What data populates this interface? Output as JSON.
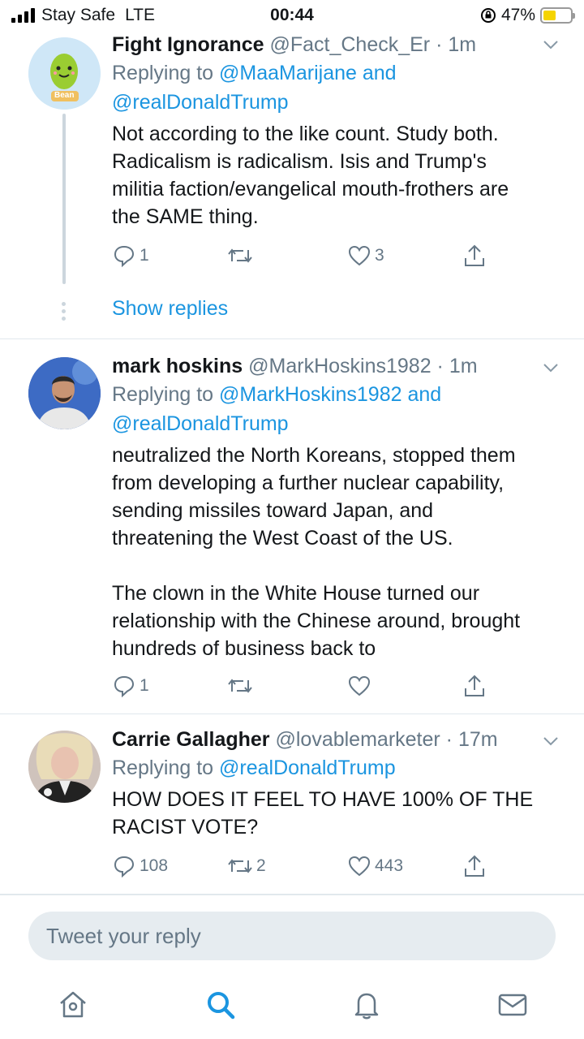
{
  "status_bar": {
    "carrier": "Stay Safe",
    "network": "LTE",
    "time": "00:44",
    "battery_percent": "47%",
    "battery_level": 0.47
  },
  "tweets": [
    {
      "name": "Fight Ignorance",
      "handle": "@Fact_Check_Er",
      "time": "1m",
      "reply_prefix": "Replying to ",
      "reply_mention_1": "@MaaMarijane and",
      "reply_mention_2": "@realDonaldTrump",
      "text": "Not according to the like count. Study both.\nRadicalism is radicalism. Isis and Trump's\nmilitia faction/evangelical mouth-frothers are\nthe SAME thing.",
      "reply_count": "1",
      "retweet_count": "",
      "like_count": "3",
      "avatar_label": "Bean",
      "show_replies": "Show replies"
    },
    {
      "name": "mark hoskins",
      "handle": "@MarkHoskins1982",
      "time": "1m",
      "reply_prefix": "Replying to ",
      "reply_mention_1": "@MarkHoskins1982 and",
      "reply_mention_2": "@realDonaldTrump",
      "text": "neutralized the North Koreans, stopped them\nfrom developing a further nuclear capability,\nsending missiles toward Japan, and\nthreatening the West Coast of the US.\n\nThe clown in the White House turned our\nrelationship with the Chinese around, brought\nhundreds of business back to",
      "reply_count": "1",
      "retweet_count": "",
      "like_count": ""
    },
    {
      "name": "Carrie Gallagher",
      "handle": "@lovablemarketer",
      "time": "17m",
      "reply_prefix": "Replying to ",
      "reply_mention_1": "@realDonaldTrump",
      "text": "HOW DOES IT FEEL TO HAVE 100% OF THE\nRACIST VOTE?",
      "reply_count": "108",
      "retweet_count": "2",
      "like_count": "443"
    }
  ],
  "reply_bar": {
    "placeholder": "Tweet your reply"
  },
  "tab_bar": {
    "icons": [
      "home-icon",
      "search-icon",
      "notifications-icon",
      "messages-icon"
    ],
    "active": "search-icon"
  },
  "colors": {
    "link": "#1b95e0",
    "secondary": "#657786",
    "divider": "#e1e8ed",
    "battery": "#f5d400"
  }
}
